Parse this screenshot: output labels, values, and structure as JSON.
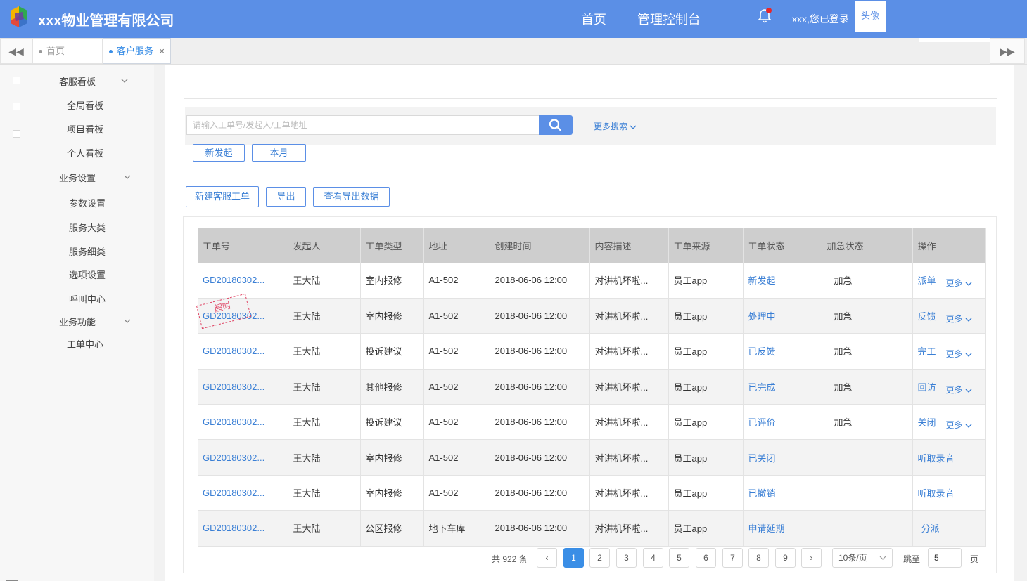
{
  "header": {
    "company": "xxx物业管理有限公司",
    "nav_home": "首页",
    "nav_console": "管理控制台",
    "login_text": "xxx,您已登录",
    "avatar": "头像"
  },
  "tabs": {
    "prev_icon": "◀◀",
    "next_icon": "▶▶",
    "home": "首页",
    "service": "客户服务",
    "close": "×"
  },
  "sidebar": {
    "groups": [
      "客服看板",
      "业务设置",
      "业务功能"
    ],
    "board_items": [
      "全局看板",
      "项目看板",
      "个人看板"
    ],
    "settings_items": [
      "参数设置",
      "服务大类",
      "服务细类",
      "选项设置",
      "呼叫中心"
    ],
    "function_items": [
      "工单中心"
    ]
  },
  "search": {
    "placeholder": "请输入工单号/发起人/工单地址",
    "value": "",
    "more": "更多搜索"
  },
  "filters": {
    "new": "新发起",
    "month": "本月"
  },
  "actions": {
    "create": "新建客服工单",
    "export": "导出",
    "view_export": "查看导出数据"
  },
  "table": {
    "columns": [
      "工单号",
      "发起人",
      "工单类型",
      "地址",
      "创建时间",
      "内容描述",
      "工单来源",
      "工单状态",
      "加急状态",
      "操作"
    ],
    "stamp": "超时",
    "more": "更多",
    "rows": [
      [
        "GD20180302...",
        "王大陆",
        "室内报修",
        "A1-502",
        "2018-06-06 12:00",
        "对讲机坏啦...",
        "员工app",
        "新发起",
        "加急",
        "派单"
      ],
      [
        "GD20180302...",
        "王大陆",
        "室内报修",
        "A1-502",
        "2018-06-06 12:00",
        "对讲机坏啦...",
        "员工app",
        "处理中",
        "加急",
        "反馈"
      ],
      [
        "GD20180302...",
        "王大陆",
        "投诉建议",
        "A1-502",
        "2018-06-06 12:00",
        "对讲机坏啦...",
        "员工app",
        "已反馈",
        "加急",
        "完工"
      ],
      [
        "GD20180302...",
        "王大陆",
        "其他报修",
        "A1-502",
        "2018-06-06 12:00",
        "对讲机坏啦...",
        "员工app",
        "已完成",
        "加急",
        "回访"
      ],
      [
        "GD20180302...",
        "王大陆",
        "投诉建议",
        "A1-502",
        "2018-06-06 12:00",
        "对讲机坏啦...",
        "员工app",
        "已评价",
        "加急",
        "关闭"
      ],
      [
        "GD20180302...",
        "王大陆",
        "室内报修",
        "A1-502",
        "2018-06-06 12:00",
        "对讲机坏啦...",
        "员工app",
        "已关闭",
        "",
        "听取录音"
      ],
      [
        "GD20180302...",
        "王大陆",
        "室内报修",
        "A1-502",
        "2018-06-06 12:00",
        "对讲机坏啦...",
        "员工app",
        "已撤销",
        "",
        "听取录音"
      ],
      [
        "GD20180302...",
        "王大陆",
        "公区报修",
        "地下车库",
        "2018-06-06 12:00",
        "对讲机坏啦...",
        "员工app",
        "申请延期",
        "",
        "分派"
      ]
    ],
    "rows_with_more": [
      0,
      1,
      2,
      3,
      4
    ]
  },
  "pagination": {
    "total": "共 922 条",
    "prev": "‹",
    "next": "›",
    "pages": [
      "1",
      "2",
      "3",
      "4",
      "5",
      "6",
      "7",
      "8",
      "9"
    ],
    "active_page": "1",
    "page_size": "10条/页",
    "jump_label": "跳至",
    "jump_value": "5",
    "page_unit": "页"
  },
  "colors": {
    "header_bg": "#5b8fe6",
    "link": "#3a7fd5",
    "active_page": "#3a8ee6",
    "stamp": "#e04565"
  }
}
